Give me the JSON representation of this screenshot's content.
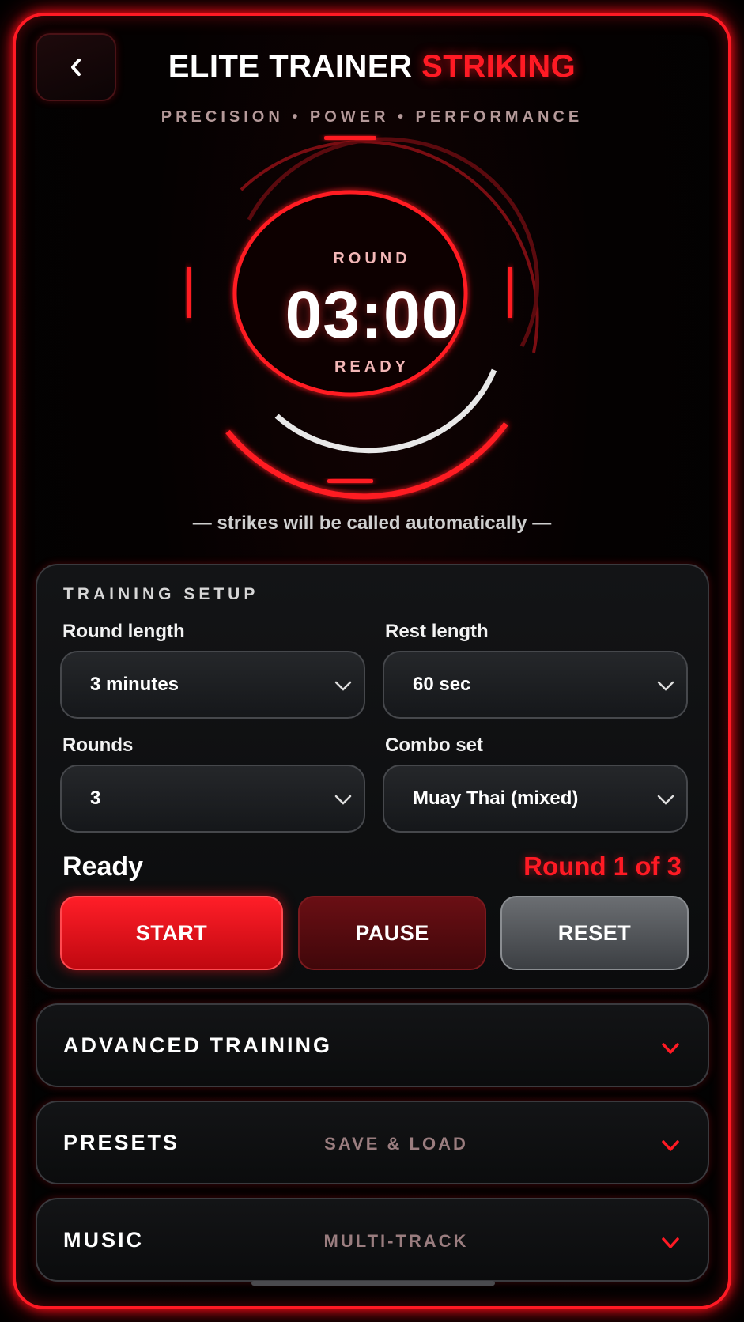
{
  "header": {
    "title_main": "ELITE TRAINER",
    "title_accent": "STRIKING",
    "tagline": "PRECISION • POWER • PERFORMANCE"
  },
  "timer": {
    "label_top": "ROUND",
    "time": "03:00",
    "label_bottom": "READY",
    "hint": "— strikes will be called automatically —"
  },
  "setup": {
    "title": "TRAINING SETUP",
    "fields": {
      "round_length": {
        "label": "Round length",
        "value": "3 minutes"
      },
      "rest_length": {
        "label": "Rest length",
        "value": "60 sec"
      },
      "rounds": {
        "label": "Rounds",
        "value": "3"
      },
      "combo_set": {
        "label": "Combo set",
        "value": "Muay Thai (mixed)"
      }
    },
    "status": "Ready",
    "round_counter": "Round 1 of 3",
    "buttons": {
      "start": "START",
      "pause": "PAUSE",
      "reset": "RESET"
    }
  },
  "sections": [
    {
      "title": "ADVANCED TRAINING",
      "subtitle": ""
    },
    {
      "title": "PRESETS",
      "subtitle": "SAVE & LOAD"
    },
    {
      "title": "MUSIC",
      "subtitle": "MULTI-TRACK"
    }
  ],
  "icons": {
    "back": "chevron-left-icon",
    "dropdown": "chevron-down-icon",
    "expand": "chevron-down-icon"
  },
  "colors": {
    "accent": "#ff1a24",
    "background": "#000000",
    "panel": "#131416",
    "muted": "#b59a9a"
  }
}
